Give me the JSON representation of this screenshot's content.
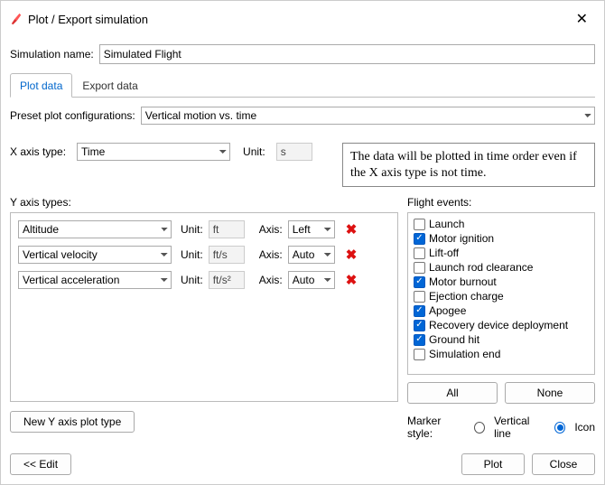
{
  "window": {
    "title": "Plot / Export simulation"
  },
  "simulation_name": {
    "label": "Simulation name:",
    "value": "Simulated Flight"
  },
  "tabs": {
    "plot_data": "Plot data",
    "export_data": "Export data"
  },
  "preset": {
    "label": "Preset plot configurations:",
    "value": "Vertical motion vs. time"
  },
  "xaxis": {
    "label": "X axis type:",
    "value": "Time",
    "unit_label": "Unit:",
    "unit": "s"
  },
  "note": {
    "text": "The data will be plotted in time order even if the X axis type is not time."
  },
  "yheader": "Y axis types:",
  "yunits_label": "Unit:",
  "yaxis_label": "Axis:",
  "yrows": [
    {
      "name": "Altitude",
      "unit": "ft",
      "axis": "Left"
    },
    {
      "name": "Vertical velocity",
      "unit": "ft/s",
      "axis": "Auto"
    },
    {
      "name": "Vertical acceleration",
      "unit": "ft/s²",
      "axis": "Auto"
    }
  ],
  "events": {
    "header": "Flight events:",
    "items": [
      {
        "label": "Launch",
        "checked": false
      },
      {
        "label": "Motor ignition",
        "checked": true
      },
      {
        "label": "Lift-off",
        "checked": false
      },
      {
        "label": "Launch rod clearance",
        "checked": false
      },
      {
        "label": "Motor burnout",
        "checked": true
      },
      {
        "label": "Ejection charge",
        "checked": false
      },
      {
        "label": "Apogee",
        "checked": true
      },
      {
        "label": "Recovery device deployment",
        "checked": true
      },
      {
        "label": "Ground hit",
        "checked": true
      },
      {
        "label": "Simulation end",
        "checked": false
      }
    ],
    "all": "All",
    "none": "None"
  },
  "marker": {
    "label": "Marker style:",
    "vertical": "Vertical line",
    "icon": "Icon",
    "selected": "icon"
  },
  "buttons": {
    "new_y": "New Y axis plot type",
    "edit": "<< Edit",
    "plot": "Plot",
    "close": "Close"
  }
}
